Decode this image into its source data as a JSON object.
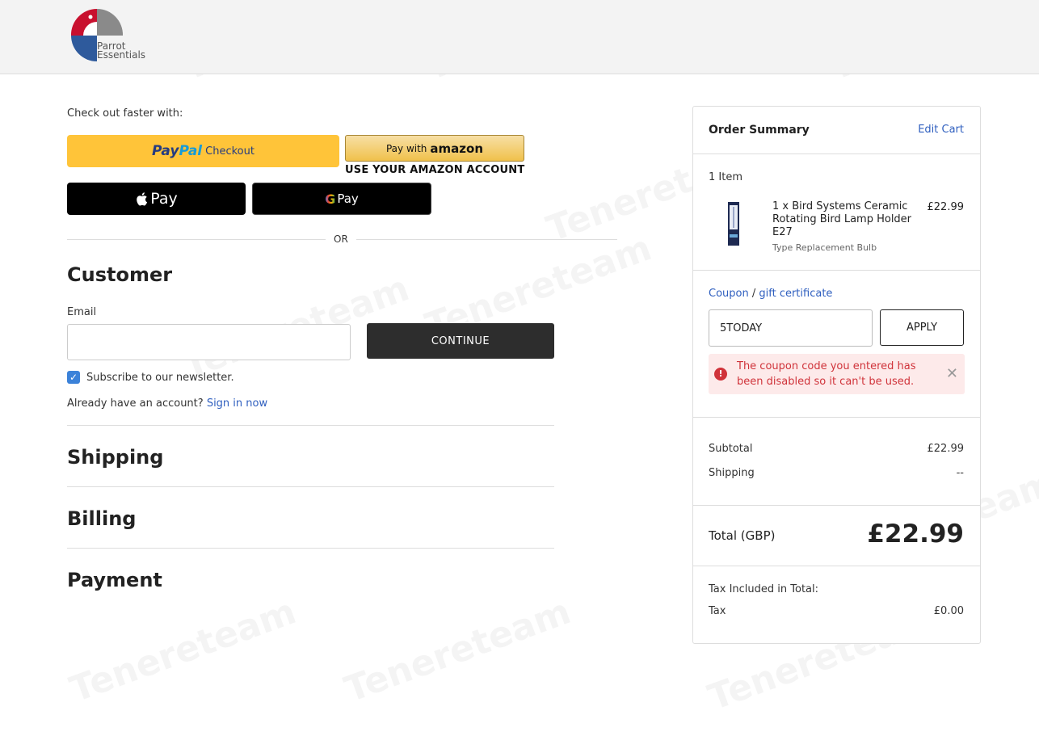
{
  "brand": {
    "logo_line1": "Parrot",
    "logo_line2": "Essentials"
  },
  "express": {
    "heading": "Check out faster with:",
    "paypal_pay": "Pay",
    "paypal_pal": "Pal",
    "paypal_checkout": "Checkout",
    "amazon_prefix": "Pay with",
    "amazon_brand": "amazon",
    "amazon_sub": "USE YOUR AMAZON ACCOUNT",
    "apple_pay": "Pay",
    "google_g": "G",
    "google_pay": "Pay",
    "or": "OR"
  },
  "customer": {
    "title": "Customer",
    "email_label": "Email",
    "email_value": "",
    "continue_label": "CONTINUE",
    "subscribe_label": "Subscribe to our newsletter.",
    "subscribe_checked": true,
    "account_text": "Already have an account?",
    "sign_in_label": "Sign in now"
  },
  "steps": {
    "shipping": "Shipping",
    "billing": "Billing",
    "payment": "Payment"
  },
  "summary": {
    "title": "Order Summary",
    "edit_cart": "Edit Cart",
    "item_count": "1 Item",
    "item": {
      "name": "1 x Bird Systems Ceramic Rotating Bird Lamp Holder E27",
      "option": "Type Replacement Bulb",
      "price": "£22.99"
    },
    "coupon_label": "Coupon",
    "coupon_sep": " / ",
    "gift_label": "gift certificate",
    "coupon_value": "5TODAY",
    "apply_label": "APPLY",
    "error_message": "The coupon code you entered has been disabled so it can't be used.",
    "subtotal_label": "Subtotal",
    "subtotal_value": "£22.99",
    "shipping_label": "Shipping",
    "shipping_value": "--",
    "total_label": "Total (GBP)",
    "total_value": "£22.99",
    "tax_heading": "Tax Included in Total:",
    "tax_label": "Tax",
    "tax_value": "£0.00"
  },
  "watermark": "Tenereteam",
  "colors": {
    "paypal": "#ffc439",
    "link": "#2f5fbf",
    "error": "#d0333a",
    "error_bg": "#fdeaea",
    "continue_bg": "#2d2d2d"
  }
}
